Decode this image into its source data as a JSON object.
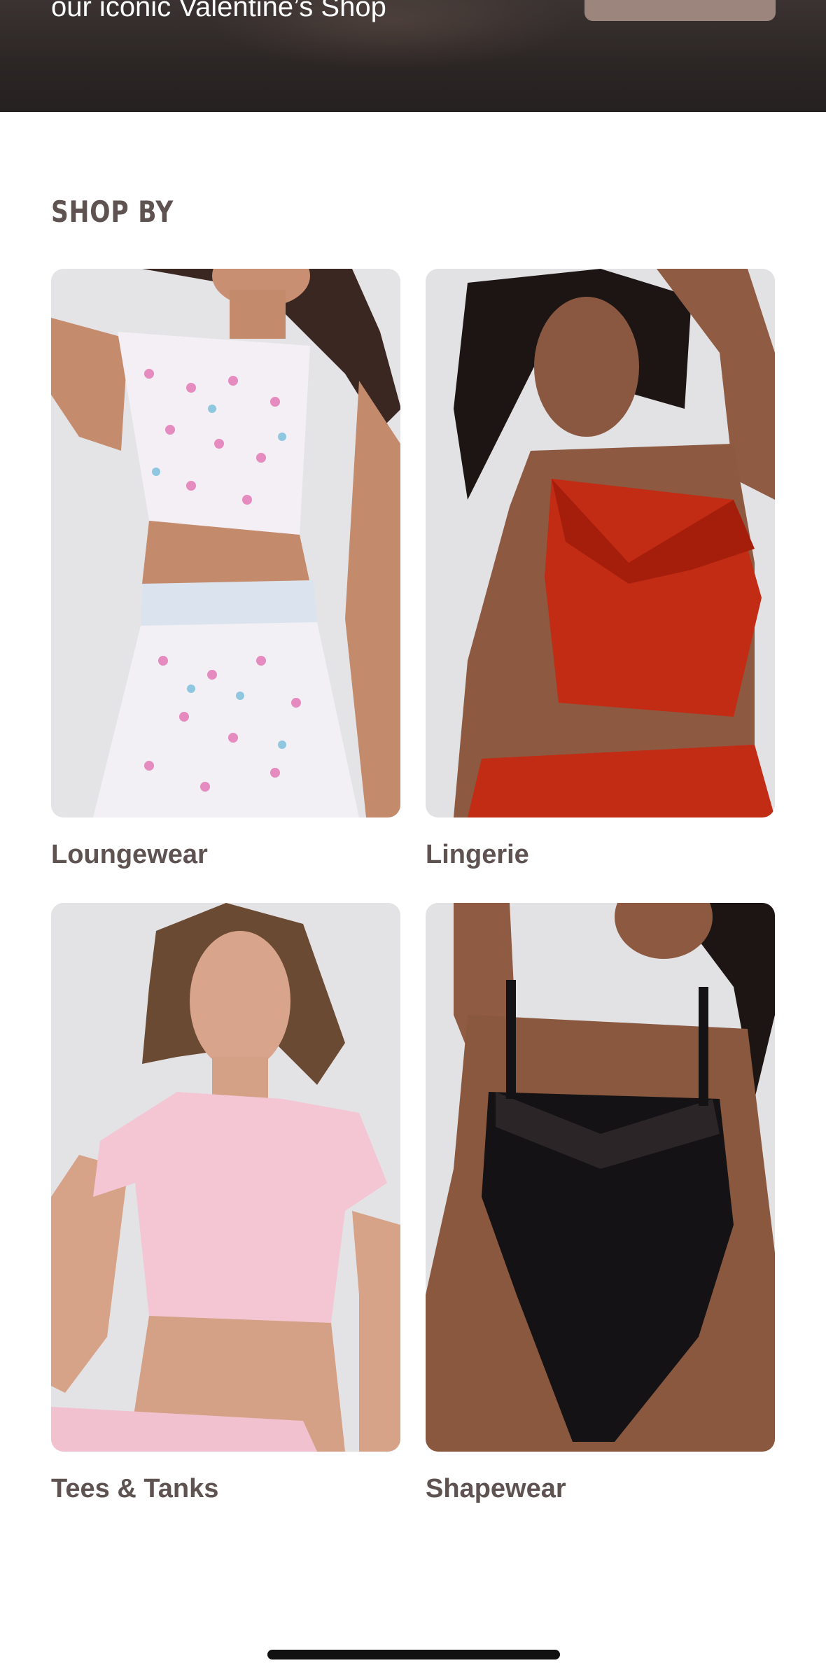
{
  "hero": {
    "text": "our iconic Valentine’s Shop",
    "button_color": "#9c857c"
  },
  "shop_by": {
    "title": "SHOP BY",
    "categories": [
      {
        "label": "Loungewear",
        "image": "model-in-heart-print-loungewear"
      },
      {
        "label": "Lingerie",
        "image": "model-in-red-lace-cami"
      },
      {
        "label": "Tees & Tanks",
        "image": "model-in-pink-tee"
      },
      {
        "label": "Shapewear",
        "image": "model-in-black-lace-bodysuit"
      }
    ]
  },
  "colors": {
    "text": "#5e5351",
    "hero_bg": "#2b2524",
    "card_bg": "#e6e4e6"
  }
}
